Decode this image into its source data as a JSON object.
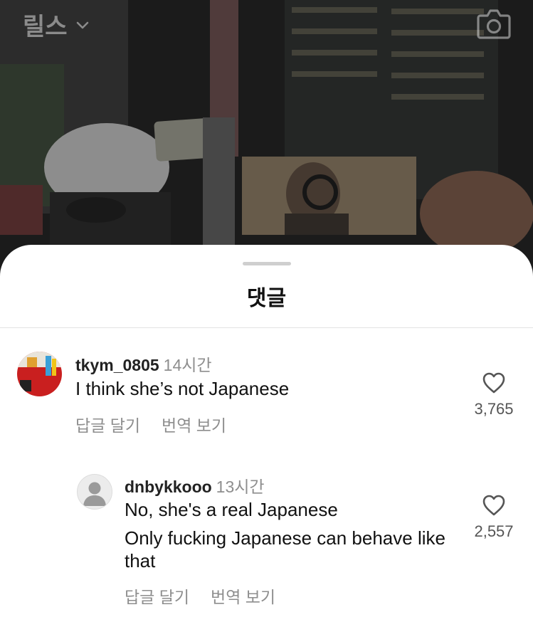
{
  "header": {
    "title": "릴스",
    "camera_icon": "camera-icon",
    "chevron_icon": "chevron-down-icon"
  },
  "sheet": {
    "title": "댓글"
  },
  "comments": [
    {
      "username": "tkym_0805",
      "time": "14시간",
      "text": "I think she’s not Japanese",
      "reply_label": "답글 달기",
      "translate_label": "번역 보기",
      "likes": "3,765",
      "avatar": "profile-photo"
    },
    {
      "username": "dnbykkooo",
      "time": "13시간",
      "text_lines": [
        "No, she's a real Japanese",
        "Only fucking Japanese can behave like that"
      ],
      "reply_label": "답글 달기",
      "translate_label": "번역 보기",
      "likes": "2,557",
      "avatar": "default-avatar"
    }
  ],
  "colors": {
    "sheet_bg": "#ffffff",
    "secondary_text": "#8e8e8e",
    "primary_text": "#111111"
  }
}
